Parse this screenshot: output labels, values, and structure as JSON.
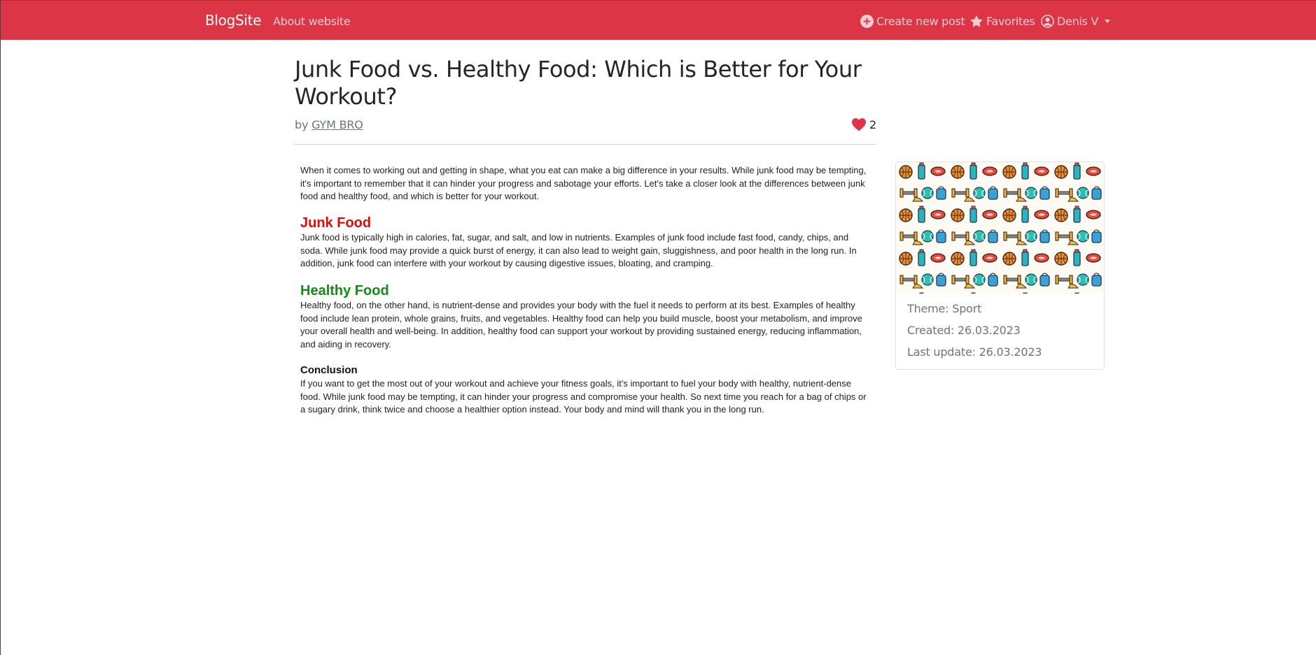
{
  "navbar": {
    "brand": "BlogSite",
    "about": "About website",
    "create": "Create new post",
    "favorites": "Favorites",
    "user": "Denis V",
    "accent_color": "#dc3545"
  },
  "post": {
    "title": "Junk Food vs. Healthy Food: Which is Better for Your Workout?",
    "by_prefix": "by",
    "author": "GYM BRO",
    "likes": "2",
    "intro": "When it comes to working out and getting in shape, what you eat can make a big difference in your results. While junk food may be tempting, it's important to remember that it can hinder your progress and sabotage your efforts. Let's take a closer look at the differences between junk food and healthy food, and which is better for your workout.",
    "junk_heading": "Junk Food",
    "junk_text": "Junk food is typically high in calories, fat, sugar, and salt, and low in nutrients. Examples of junk food include fast food, candy, chips, and soda. While junk food may provide a quick burst of energy, it can also lead to weight gain, sluggishness, and poor health in the long run. In addition, junk food can interfere with your workout by causing digestive issues, bloating, and cramping.",
    "healthy_heading": "Healthy Food",
    "healthy_text": "Healthy food, on the other hand, is nutrient-dense and provides your body with the fuel it needs to perform at its best. Examples of healthy food include lean protein, whole grains, fruits, and vegetables. Healthy food can help you build muscle, boost your metabolism, and improve your overall health and well-being. In addition, healthy food can support your workout by providing sustained energy, reducing inflammation, and aiding in recovery.",
    "conclusion_heading": "Conclusion",
    "conclusion_text": "If you want to get the most out of your workout and achieve your fitness goals, it's important to fuel your body with healthy, nutrient-dense food. While junk food may be tempting, it can hinder your progress and compromise your health. So next time you reach for a bag of chips or a sugary drink, think twice and choose a healthier option instead. Your body and mind will thank you in the long run."
  },
  "sidebar": {
    "theme": "Theme: Sport",
    "created": "Created: 26.03.2023",
    "updated": "Last update: 26.03.2023",
    "image_icon": "sport-pattern-image"
  }
}
